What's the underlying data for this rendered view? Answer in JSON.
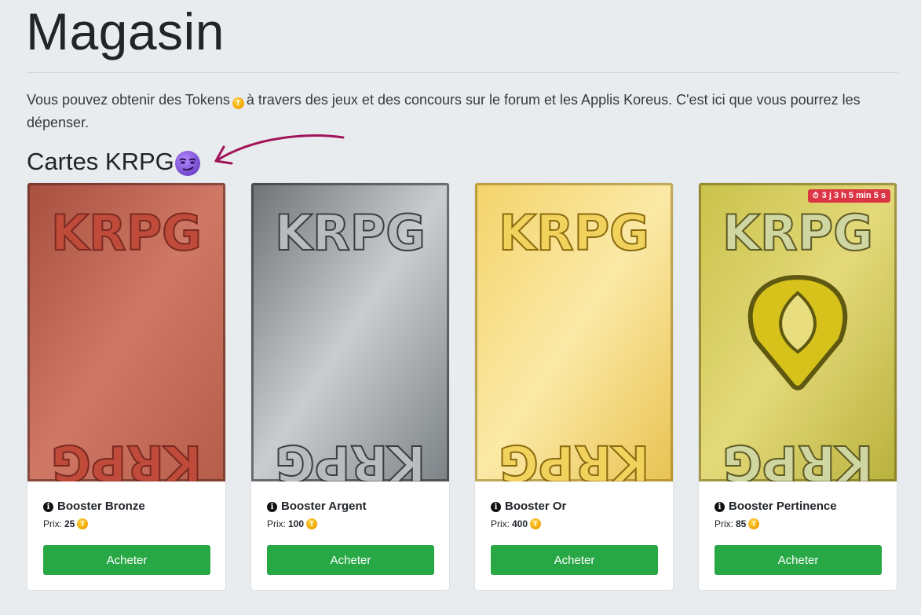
{
  "page": {
    "title": "Magasin",
    "intro_part1": "Vous pouvez obtenir des Tokens",
    "intro_part2": "à travers des jeux et des concours sur le forum et les Applis Koreus. C'est ici que vous pourrez les dépenser.",
    "token_icon": "token-coin-icon"
  },
  "section": {
    "title": "Cartes KRPG",
    "emoji_icon": "smirk-emoji-icon"
  },
  "colors": {
    "background": "#e9ecef",
    "button": "#28a745",
    "timer": "#dc3545",
    "arrow": "#a0145a"
  },
  "cards": [
    {
      "name": "Booster Bronze",
      "price_label": "Prix:",
      "price": "25",
      "button": "Acheter",
      "brand_text": "KRPG"
    },
    {
      "name": "Booster Argent",
      "price_label": "Prix:",
      "price": "100",
      "button": "Acheter",
      "brand_text": "KRPG"
    },
    {
      "name": "Booster Or",
      "price_label": "Prix:",
      "price": "400",
      "button": "Acheter",
      "brand_text": "KRPG"
    },
    {
      "name": "Booster Pertinence",
      "price_label": "Prix:",
      "price": "85",
      "button": "Acheter",
      "brand_text": "KRPG",
      "timer": "3 j 3 h 5 min 5 s"
    }
  ]
}
